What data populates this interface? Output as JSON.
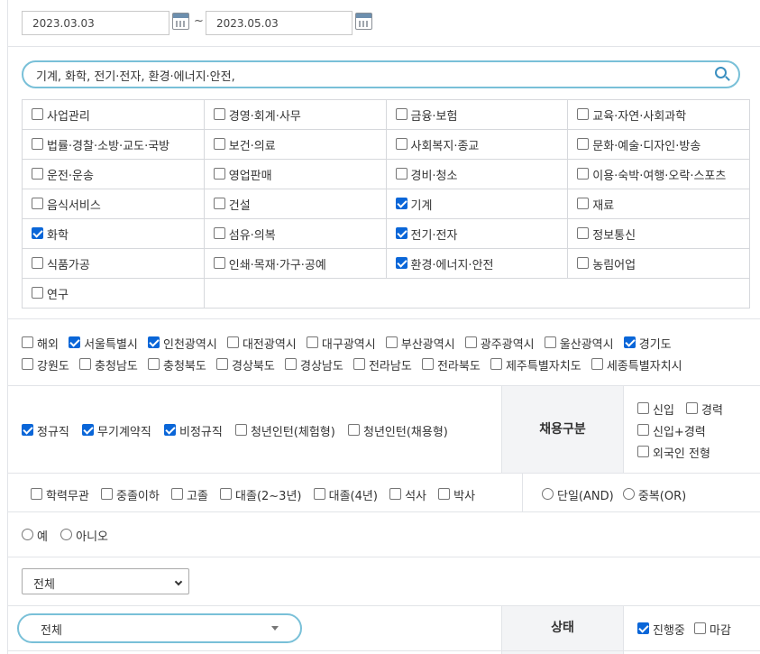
{
  "date_range": {
    "start": "2023.03.03",
    "separator": "~",
    "end": "2023.05.03"
  },
  "search": {
    "value": "기계, 화학, 전기·전자, 환경·에너지·안전,"
  },
  "categories": [
    {
      "label": "사업관리",
      "checked": false
    },
    {
      "label": "경영·회계·사무",
      "checked": false
    },
    {
      "label": "금융·보험",
      "checked": false
    },
    {
      "label": "교육·자연·사회과학",
      "checked": false
    },
    {
      "label": "법률·경찰·소방·교도·국방",
      "checked": false
    },
    {
      "label": "보건·의료",
      "checked": false
    },
    {
      "label": "사회복지·종교",
      "checked": false
    },
    {
      "label": "문화·예술·디자인·방송",
      "checked": false
    },
    {
      "label": "운전·운송",
      "checked": false
    },
    {
      "label": "영업판매",
      "checked": false
    },
    {
      "label": "경비·청소",
      "checked": false
    },
    {
      "label": "이용·숙박·여행·오락·스포츠",
      "checked": false
    },
    {
      "label": "음식서비스",
      "checked": false
    },
    {
      "label": "건설",
      "checked": false
    },
    {
      "label": "기계",
      "checked": true
    },
    {
      "label": "재료",
      "checked": false
    },
    {
      "label": "화학",
      "checked": true
    },
    {
      "label": "섬유·의복",
      "checked": false
    },
    {
      "label": "전기·전자",
      "checked": true
    },
    {
      "label": "정보통신",
      "checked": false
    },
    {
      "label": "식품가공",
      "checked": false
    },
    {
      "label": "인쇄·목재·가구·공예",
      "checked": false
    },
    {
      "label": "환경·에너지·안전",
      "checked": true
    },
    {
      "label": "농림어업",
      "checked": false
    },
    {
      "label": "연구",
      "checked": false
    }
  ],
  "regions_row1": [
    {
      "label": "해외",
      "checked": false
    },
    {
      "label": "서울특별시",
      "checked": true
    },
    {
      "label": "인천광역시",
      "checked": true
    },
    {
      "label": "대전광역시",
      "checked": false
    },
    {
      "label": "대구광역시",
      "checked": false
    },
    {
      "label": "부산광역시",
      "checked": false
    },
    {
      "label": "광주광역시",
      "checked": false
    },
    {
      "label": "울산광역시",
      "checked": false
    },
    {
      "label": "경기도",
      "checked": true
    }
  ],
  "regions_row2": [
    {
      "label": "강원도",
      "checked": false
    },
    {
      "label": "충청남도",
      "checked": false
    },
    {
      "label": "충청북도",
      "checked": false
    },
    {
      "label": "경상북도",
      "checked": false
    },
    {
      "label": "경상남도",
      "checked": false
    },
    {
      "label": "전라남도",
      "checked": false
    },
    {
      "label": "전라북도",
      "checked": false
    },
    {
      "label": "제주특별자치도",
      "checked": false
    },
    {
      "label": "세종특별자치시",
      "checked": false
    }
  ],
  "employment_types": [
    {
      "label": "정규직",
      "checked": true
    },
    {
      "label": "무기계약직",
      "checked": true
    },
    {
      "label": "비정규직",
      "checked": true
    },
    {
      "label": "청년인턴(체험형)",
      "checked": false
    },
    {
      "label": "청년인턴(채용형)",
      "checked": false
    }
  ],
  "hiring_section_label": "채용구분",
  "career_options": {
    "new": "신입",
    "experienced": "경력",
    "both": "신입+경력",
    "foreigner": "외국인 전형"
  },
  "education": [
    {
      "label": "학력무관",
      "checked": false
    },
    {
      "label": "중졸이하",
      "checked": false
    },
    {
      "label": "고졸",
      "checked": false
    },
    {
      "label": "대졸(2~3년)",
      "checked": false
    },
    {
      "label": "대졸(4년)",
      "checked": false
    },
    {
      "label": "석사",
      "checked": false
    },
    {
      "label": "박사",
      "checked": false
    }
  ],
  "match_mode": {
    "single": "단일(AND)",
    "multiple": "중복(OR)"
  },
  "yes_no": {
    "yes": "예",
    "no": "아니오"
  },
  "select_all": "전체",
  "status_select": "전체",
  "status_label": "상태",
  "status_options": {
    "ongoing": "진행중",
    "closed": "마감"
  },
  "colors": {
    "accent": "#79c0d8",
    "checked": "#0a66d8",
    "label_bg": "#f3f4f6",
    "border": "#d6d8dc"
  }
}
